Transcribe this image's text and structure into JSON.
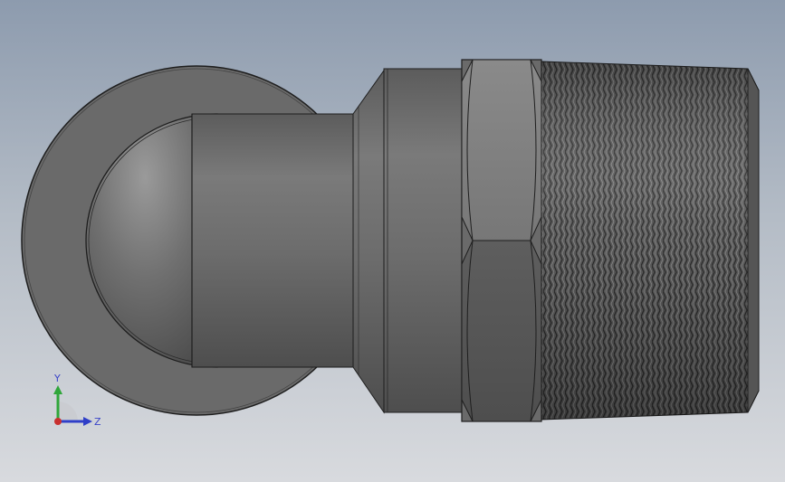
{
  "viewport": {
    "background_top": "#8d9bae",
    "background_bottom": "#d8dade"
  },
  "model": {
    "part": "swivel-ball-joint-fitting",
    "body_color": "#6e6e6e",
    "edge_color": "#1e1e1e",
    "knurl_color": "#3a3a3a"
  },
  "triad": {
    "y_label": "Y",
    "z_label": "Z",
    "y_color": "#2fa63a",
    "z_color": "#2f3fc8",
    "x_color": "#c8302f"
  }
}
